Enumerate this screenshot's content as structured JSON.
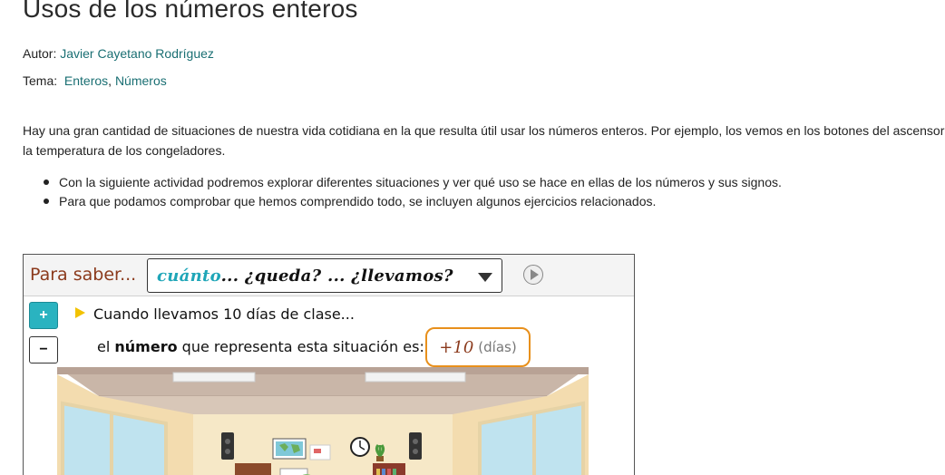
{
  "page": {
    "title": "Usos de los números enteros",
    "author_label": "Autor:",
    "author_name": "Javier Cayetano Rodríguez",
    "topic_label": "Tema:",
    "topic_link_1": "Enteros",
    "topic_sep": ",",
    "topic_link_2": "Números",
    "intro": "Hay una gran cantidad de situaciones de nuestra vida cotidiana en la que resulta útil usar los números enteros. Por ejemplo, los vemos en los botones del ascensor y la temperatura de los congeladores.",
    "bullets": [
      "Con la siguiente actividad podremos explorar diferentes situaciones y ver qué uso se hace en ellas de los números y sus signos.",
      "Para que podamos comprobar que hemos comprendido todo, se incluyen algunos ejercicios relacionados."
    ]
  },
  "activity": {
    "header_label": "Para saber...",
    "select_highlight": "cuánto",
    "select_rest": "... ¿queda? ... ¿llevamos?",
    "plus_label": "+",
    "minus_label": "−",
    "situation": "Cuando llevamos 10 días de clase...",
    "number_prefix": "el",
    "number_bold": "número",
    "number_suffix": "que representa esta situación es:",
    "answer_value": "+10",
    "answer_unit": "(días)"
  },
  "colors": {
    "link": "#1a6f73",
    "header_label": "#8b3a1c",
    "select_highlight": "#1fa6b8",
    "plus_button": "#2ab3c0",
    "answer_border": "#e8901c",
    "triangle": "#f2c200"
  },
  "icons": [
    "caret-down-icon",
    "play-icon",
    "triangle-right-icon",
    "clock-icon",
    "speaker-icon",
    "map-icon",
    "plant-icon"
  ]
}
